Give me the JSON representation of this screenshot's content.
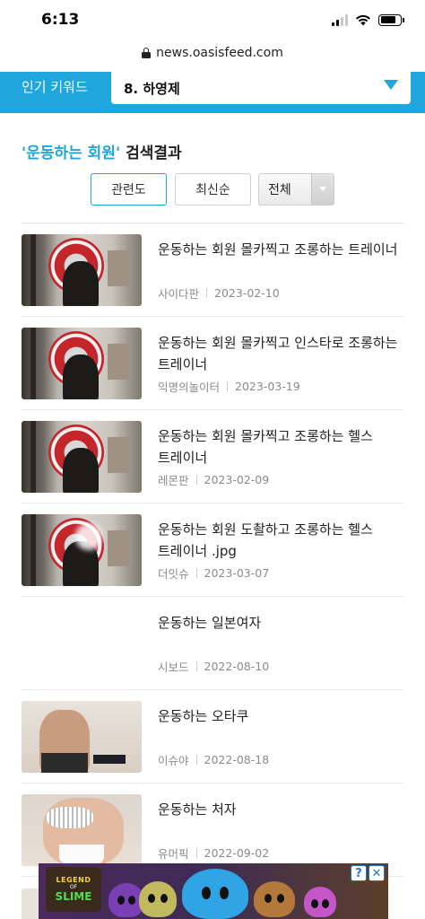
{
  "status_bar": {
    "time": "6:13"
  },
  "browser": {
    "url": "news.oasisfeed.com"
  },
  "keyword_bar": {
    "label": "인기 키워드",
    "selected": "8. 하영제"
  },
  "search": {
    "query": "'운동하는 회원'",
    "suffix": " 검색결과"
  },
  "sort": {
    "relevance": "관련도",
    "latest": "최신순",
    "filter_selected": "전체"
  },
  "results": [
    {
      "title": "운동하는 회원 몰카찍고 조롱하는 트레이너",
      "source": "사이다판",
      "date": "2023-02-10",
      "thumb": "gym"
    },
    {
      "title": "운동하는 회원 몰카찍고 인스타로 조롱하는 트레이너",
      "source": "익명의놀이터",
      "date": "2023-03-19",
      "thumb": "gym"
    },
    {
      "title": "운동하는 회원 몰카찍고 조롱하는 헬스 트레이너",
      "source": "레몬판",
      "date": "2023-02-09",
      "thumb": "gym"
    },
    {
      "title": "운동하는 회원 도촬하고 조롱하는 헬스 트레이너 .jpg",
      "source": "더잇슈",
      "date": "2023-03-07",
      "thumb": "gym-blur"
    },
    {
      "title": "운동하는 일본여자",
      "source": "시보드",
      "date": "2022-08-10",
      "thumb": "none"
    },
    {
      "title": "운동하는 오타쿠",
      "source": "이슈야",
      "date": "2022-08-18",
      "thumb": "back"
    },
    {
      "title": "운동하는 처자",
      "source": "유머픽",
      "date": "2022-09-02",
      "thumb": "body"
    }
  ],
  "ad": {
    "logo_line1": "LEGEND",
    "logo_line2": "OF",
    "logo_line3": "SLIME",
    "help": "?",
    "close": "✕"
  },
  "colors": {
    "accent": "#1fa6dc"
  }
}
